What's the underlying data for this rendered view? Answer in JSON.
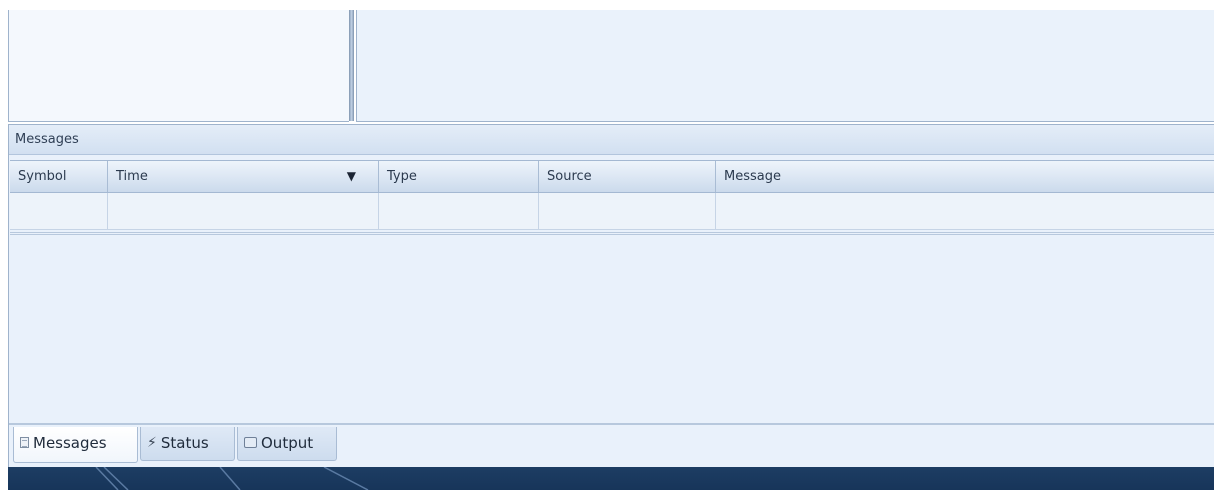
{
  "messages_panel": {
    "title": "Messages",
    "columns": [
      "Symbol",
      "Time",
      "Type",
      "Source",
      "Message"
    ],
    "sort_indicator": "▼",
    "rows": []
  },
  "tabs": [
    {
      "label": "Messages",
      "icon": "document-icon",
      "active": true
    },
    {
      "label": "Status",
      "icon": "status-icon",
      "active": false
    },
    {
      "label": "Output",
      "icon": "monitor-icon",
      "active": false
    }
  ],
  "colors": {
    "panel_bg": "#e9f1fb",
    "header_grad_top": "#eef4fb",
    "header_grad_bottom": "#cbdaec",
    "footer": "#1d3d63"
  }
}
